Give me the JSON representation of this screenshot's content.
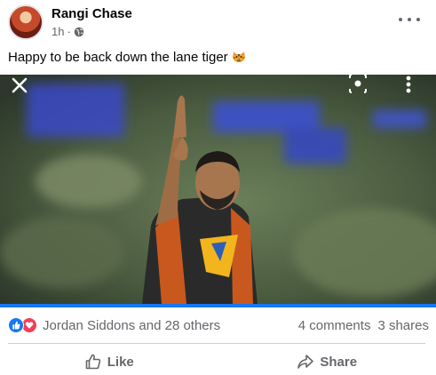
{
  "post": {
    "author": "Rangi Chase",
    "time": "1h",
    "separator": "·",
    "caption": "Happy to be back down the lane tiger",
    "caption_emoji": "tiger-face-icon"
  },
  "photo": {
    "description_icons": [
      "close-icon",
      "lens-icon",
      "more-vertical-icon"
    ]
  },
  "reactions": {
    "icons": [
      "like-icon",
      "love-icon"
    ],
    "names": "Jordan Siddons and 28 others",
    "comments": "4 comments",
    "shares": "3 shares"
  },
  "actions": {
    "like_label": "Like",
    "share_label": "Share"
  },
  "colors": {
    "accent": "#1877f2",
    "love": "#f33e58",
    "secondary_text": "#65676b"
  }
}
